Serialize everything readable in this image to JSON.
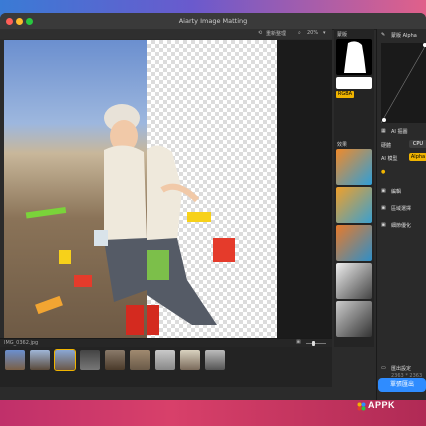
{
  "window": {
    "title": "Aiarty Image Matting"
  },
  "toolbar": {
    "reset_label": "重新整理",
    "zoom_level": "20%"
  },
  "canvas": {
    "filename": "IMG_0362.jpg"
  },
  "sidebar": {
    "header_label": "蒙版",
    "rgba_tag": "RGBA",
    "effects_label": "效果"
  },
  "panel": {
    "header_label": "蒙版 Alpha",
    "ai_section_label": "AI 摳圖",
    "device_label": "硬體",
    "device_value": "CPU",
    "ai_model_label": "AI 模型",
    "ai_model_value": "Alpha",
    "edit_label": "編輯",
    "region_select_label": "區域選擇",
    "edge_refine_label": "細節優化",
    "export_settings_label": "匯出設定",
    "export_settings_value": "2363 * 2363",
    "export_button_label": "單張匯出"
  },
  "brand": {
    "name": "APPK"
  },
  "colors": {
    "accent": "#f0b400",
    "export_button": "#2f8cff",
    "window_bg": "#2b2b2b"
  }
}
